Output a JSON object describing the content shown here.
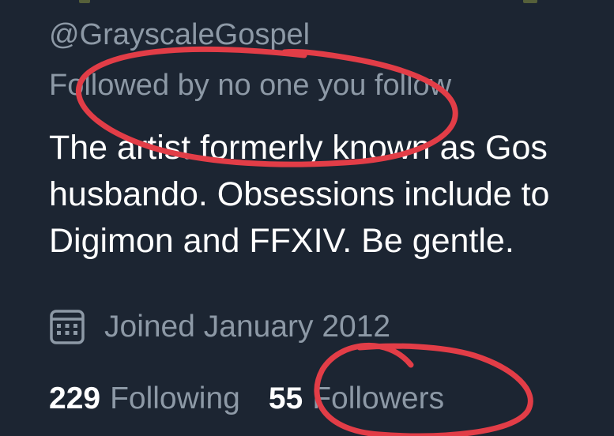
{
  "profile": {
    "handle": "@GrayscaleGospel",
    "followed_by": "Followed by no one you follow",
    "bio_lines": [
      "The artist formerly known as Gos",
      "husbando. Obsessions include to",
      "Digimon and FFXIV. Be gentle."
    ],
    "joined": "Joined January 2012",
    "following_count": "229",
    "following_label": "Following",
    "followers_count": "55",
    "followers_label": "Followers"
  },
  "icons": {
    "joined": "calendar-icon"
  },
  "colors": {
    "background": "#1c2532",
    "primary_text": "#ffffff",
    "secondary_text": "#8d99a6",
    "annotation": "#e23d47"
  }
}
